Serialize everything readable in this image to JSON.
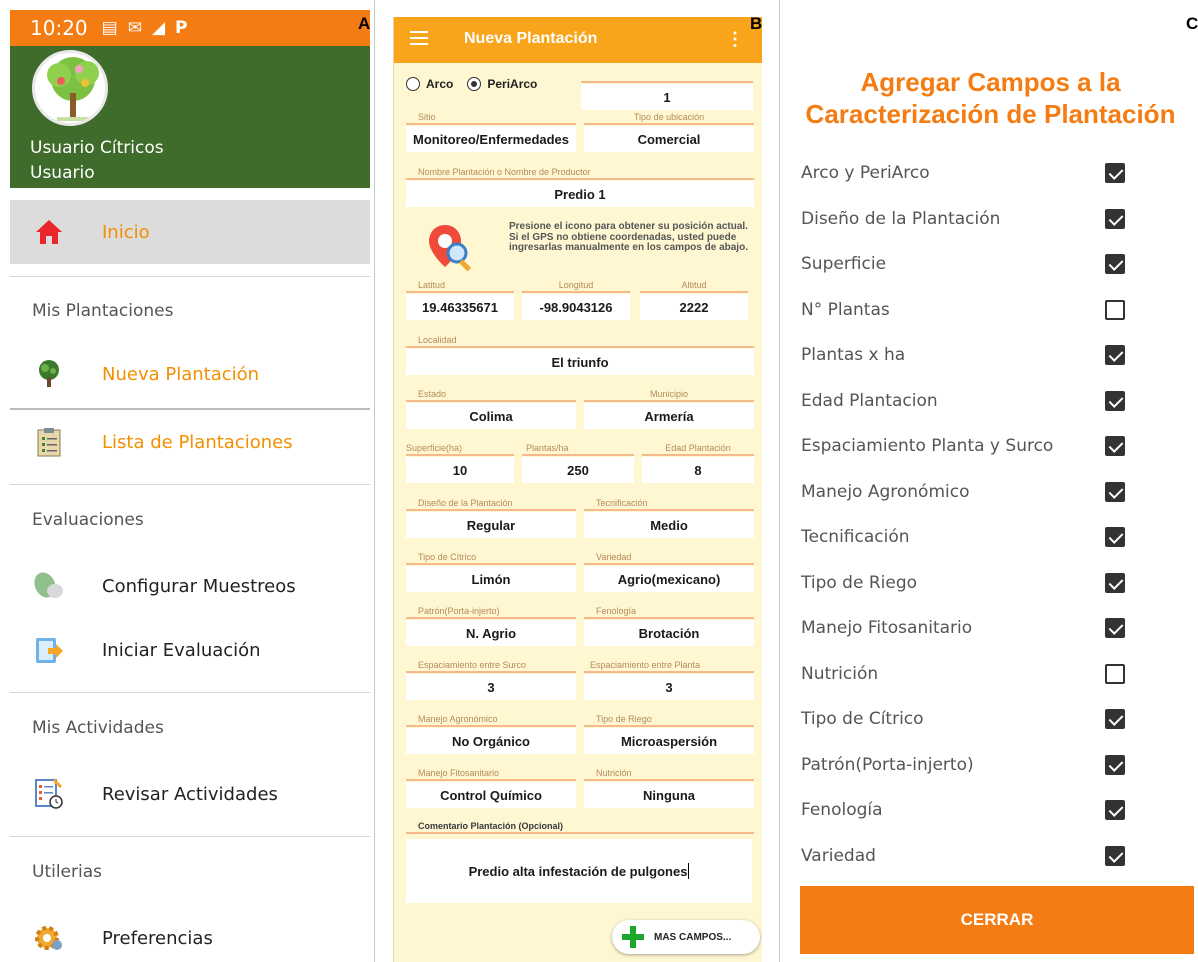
{
  "panel_letters": {
    "a": "A",
    "b": "B",
    "c": "C"
  },
  "panelA": {
    "status_bar": {
      "time": "10:20"
    },
    "user": {
      "name": "Usuario Cítricos",
      "role": "Usuario"
    },
    "menu": {
      "inicio": "Inicio",
      "section_plantaciones": "Mis Plantaciones",
      "nueva_plantacion": "Nueva Plantación",
      "lista_plantaciones": "Lista de Plantaciones",
      "section_evaluaciones": "Evaluaciones",
      "configurar_muestreos": "Configurar Muestreos",
      "iniciar_evaluacion": "Iniciar Evaluación",
      "section_actividades": "Mis Actividades",
      "revisar_actividades": "Revisar Actividades",
      "section_utilerias": "Utilerias",
      "preferencias": "Preferencias"
    },
    "colors": {
      "status_bar": "#f47c13",
      "header": "#3f6b2b",
      "accent": "#f29000",
      "selected": "#dcdcdc"
    }
  },
  "panelB": {
    "title": "Nueva Plantación",
    "radio": {
      "arco": "Arco",
      "periarco": "PeriArco",
      "selected": "PeriArco",
      "number": "1"
    },
    "sitio": {
      "label": "Sitio",
      "value": "Monitoreo/Enfermedades"
    },
    "tipo_ubicacion": {
      "label": "Tipo de ubicación",
      "value": "Comercial"
    },
    "nombre": {
      "label": "Nombre Plantación o Nombre de Productor",
      "value": "Predio 1"
    },
    "gps_hint": "Presione el icono para obtener su posición actual. Si el GPS no obtiene coordenadas, usted puede ingresarlas manualmente en los campos de abajo.",
    "latitud": {
      "label": "Latitud",
      "value": "19.46335671"
    },
    "longitud": {
      "label": "Longitud",
      "value": "-98.9043126"
    },
    "altitud": {
      "label": "Altitud",
      "value": "2222"
    },
    "localidad": {
      "label": "Localidad",
      "value": "El triunfo"
    },
    "estado": {
      "label": "Estado",
      "value": "Colima"
    },
    "municipio": {
      "label": "Municipio",
      "value": "Armería"
    },
    "superficie": {
      "label": "Superficie(ha)",
      "value": "10"
    },
    "plantas_ha": {
      "label": "Plantas/ha",
      "value": "250"
    },
    "edad": {
      "label": "Edad Plantación",
      "value": "8"
    },
    "diseno": {
      "label": "Diseño de la Plantación",
      "value": "Regular"
    },
    "tecnificacion": {
      "label": "Tecnificación",
      "value": "Medio"
    },
    "tipo_citrico": {
      "label": "Tipo de Cítrico",
      "value": "Limón"
    },
    "variedad": {
      "label": "Variedad",
      "value": "Agrio(mexicano)"
    },
    "patron": {
      "label": "Patrón(Porta-injerto)",
      "value": "N. Agrio"
    },
    "fenologia": {
      "label": "Fenología",
      "value": "Brotación"
    },
    "esp_surco": {
      "label": "Espaciamiento entre Surco",
      "value": "3"
    },
    "esp_planta": {
      "label": "Espaciamiento entre Planta",
      "value": "3"
    },
    "manejo_agro": {
      "label": "Manejo Agronómico",
      "value": "No Orgánico"
    },
    "tipo_riego": {
      "label": "Tipo de Riego",
      "value": "Microaspersión"
    },
    "manejo_fito": {
      "label": "Manejo Fitosanitario",
      "value": "Control Químico"
    },
    "nutricion": {
      "label": "Nutrición",
      "value": "Ninguna"
    },
    "comentario": {
      "label": "Comentario Plantación (Opcional)",
      "value": "Predio alta infestación de pulgones"
    },
    "more_button": "MAS CAMPOS...",
    "colors": {
      "appbar": "#f9a51b",
      "background": "#fff6d2",
      "plus": "#1aa72b"
    }
  },
  "panelC": {
    "title_line1": "Agregar Campos a la",
    "title_line2": "Caracterización de Plantación",
    "fields": [
      {
        "label": "Arco y PeriArco",
        "checked": true
      },
      {
        "label": "Diseño de la Plantación",
        "checked": true
      },
      {
        "label": "Superficie",
        "checked": true
      },
      {
        "label": "N° Plantas",
        "checked": false
      },
      {
        "label": "Plantas x ha",
        "checked": true
      },
      {
        "label": "Edad Plantacion",
        "checked": true
      },
      {
        "label": "Espaciamiento Planta y Surco",
        "checked": true
      },
      {
        "label": "Manejo Agronómico",
        "checked": true
      },
      {
        "label": "Tecnificación",
        "checked": true
      },
      {
        "label": "Tipo de Riego",
        "checked": true
      },
      {
        "label": "Manejo Fitosanitario",
        "checked": true
      },
      {
        "label": "Nutrición",
        "checked": false
      },
      {
        "label": "Tipo de Cítrico",
        "checked": true
      },
      {
        "label": "Patrón(Porta-injerto)",
        "checked": true
      },
      {
        "label": "Fenología",
        "checked": true
      },
      {
        "label": "Variedad",
        "checked": true
      }
    ],
    "close_button": "CERRAR",
    "colors": {
      "accent": "#f47c13",
      "checkbox": "#333333"
    }
  }
}
